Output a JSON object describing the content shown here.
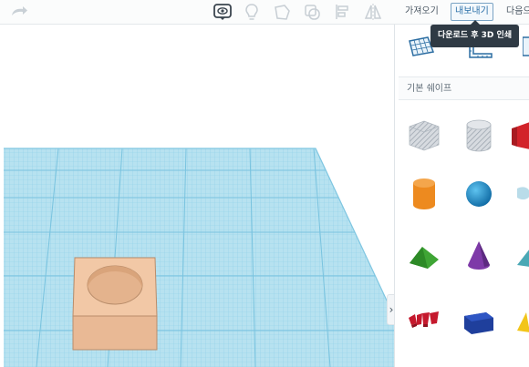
{
  "toolbar": {
    "import_label": "가져오기",
    "export_label": "내보내기",
    "send_to_label": "다음으",
    "tooltip": "다운로드 후 3D 인쇄",
    "icons": [
      "redo-icon",
      "show-all-icon",
      "note-icon",
      "workplane-icon",
      "duplicate-icon",
      "align-icon",
      "mirror-icon"
    ]
  },
  "panel": {
    "view_icons": [
      "workplane-tool-icon",
      "ruler-tool-icon",
      "view-cube-icon"
    ],
    "category_label": "기본 쉐이프",
    "shapes": [
      "box-hole",
      "cylinder-hole",
      "box",
      "cylinder",
      "sphere",
      "scribble",
      "roof",
      "cone",
      "round-roof",
      "text",
      "polygon",
      "pyramid"
    ]
  },
  "colors": {
    "grid": "#a9dced",
    "grid_line": "#7ec8e3",
    "model_face": "#f0c6a4",
    "model_side": "#e7b791",
    "tooltip_bg": "#2f3a44",
    "export_accent": "#2a6fa8"
  }
}
